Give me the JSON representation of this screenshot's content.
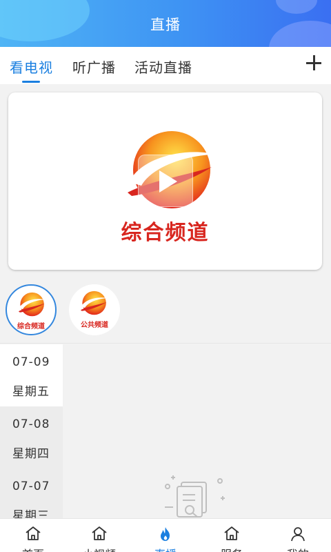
{
  "header": {
    "title": "直播"
  },
  "tabs": [
    {
      "label": "看电视",
      "active": true
    },
    {
      "label": "听广播",
      "active": false
    },
    {
      "label": "活动直播",
      "active": false
    }
  ],
  "player": {
    "logo_caption": "综合频道"
  },
  "channels": [
    {
      "name": "综合频道",
      "selected": true
    },
    {
      "name": "公共频道",
      "selected": false
    }
  ],
  "dates": [
    {
      "date": "07-09",
      "weekday": "星期五",
      "active": true
    },
    {
      "date": "07-08",
      "weekday": "星期四",
      "active": false
    },
    {
      "date": "07-07",
      "weekday": "星期三",
      "active": false
    }
  ],
  "bottom_nav": [
    {
      "label": "首页",
      "icon": "home-icon"
    },
    {
      "label": "小视频",
      "icon": "home-icon"
    },
    {
      "label": "直播",
      "icon": "flame-icon",
      "active": true
    },
    {
      "label": "服务",
      "icon": "home-icon"
    },
    {
      "label": "我的",
      "icon": "user-icon"
    }
  ],
  "colors": {
    "accent": "#1a7fe0",
    "brand_red": "#d8261f",
    "header_start": "#4fb4f5",
    "header_end": "#3a6ff2"
  }
}
